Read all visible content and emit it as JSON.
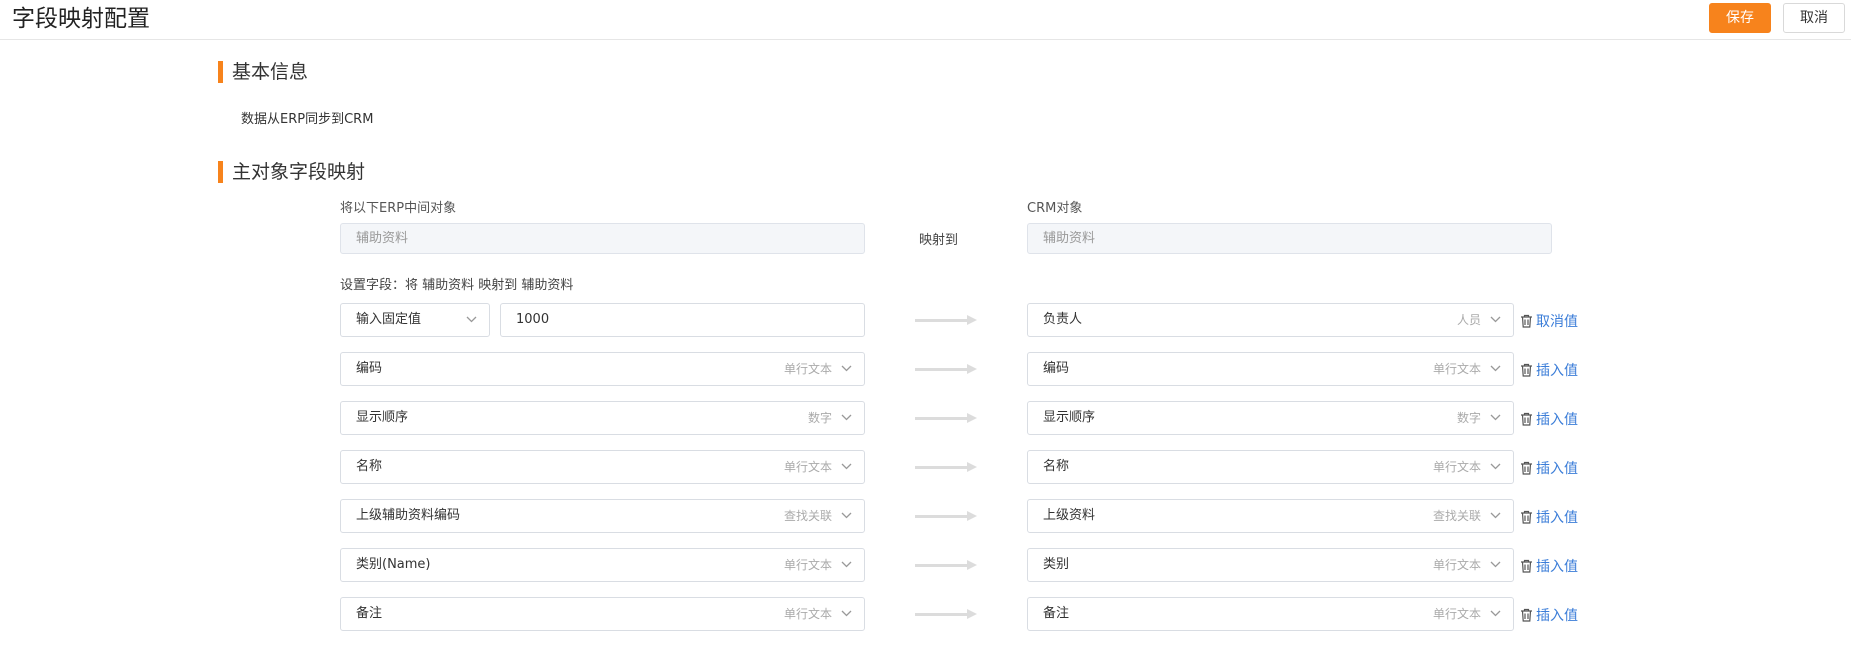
{
  "header": {
    "title": "字段映射配置",
    "save_label": "保存",
    "cancel_label": "取消"
  },
  "basic": {
    "title": "基本信息",
    "description": "数据从ERP同步到CRM"
  },
  "mapping": {
    "title": "主对象字段映射",
    "source_label": "将以下ERP中间对象",
    "source_value": "辅助资料",
    "map_to_label": "映射到",
    "target_label": "CRM对象",
    "target_value": "辅助资料",
    "settings_label": "设置字段：将 辅助资料 映射到 辅助资料",
    "fixed_row": {
      "mode": "输入固定值",
      "value": "1000"
    },
    "rows": [
      {
        "source": "",
        "source_type": "",
        "target": "负责人",
        "target_type": "人员",
        "action": "取消值"
      },
      {
        "source": "编码",
        "source_type": "单行文本",
        "target": "编码",
        "target_type": "单行文本",
        "action": "插入值"
      },
      {
        "source": "显示顺序",
        "source_type": "数字",
        "target": "显示顺序",
        "target_type": "数字",
        "action": "插入值"
      },
      {
        "source": "名称",
        "source_type": "单行文本",
        "target": "名称",
        "target_type": "单行文本",
        "action": "插入值"
      },
      {
        "source": "上级辅助资料编码",
        "source_type": "查找关联",
        "target": "上级资料",
        "target_type": "查找关联",
        "action": "插入值"
      },
      {
        "source": "类别(Name)",
        "source_type": "单行文本",
        "target": "类别",
        "target_type": "单行文本",
        "action": "插入值"
      },
      {
        "source": "备注",
        "source_type": "单行文本",
        "target": "备注",
        "target_type": "单行文本",
        "action": "插入值"
      }
    ]
  },
  "icons": {
    "chevron": "chevron-down-icon",
    "delete": "trash-icon",
    "arrow": "arrow-right-icon"
  },
  "colors": {
    "accent": "#f7831c",
    "link": "#3b7dd8"
  }
}
